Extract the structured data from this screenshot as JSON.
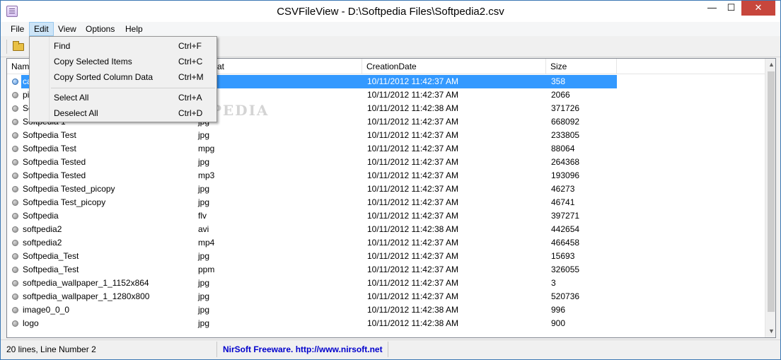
{
  "window": {
    "title": "CSVFileView  -  D:\\Softpedia Files\\Softpedia2.csv",
    "controls": {
      "minimize": "—",
      "maximize": "☐",
      "close": "✕"
    }
  },
  "menubar": {
    "items": [
      {
        "label": "File"
      },
      {
        "label": "Edit"
      },
      {
        "label": "View"
      },
      {
        "label": "Options"
      },
      {
        "label": "Help"
      }
    ],
    "active": "Edit"
  },
  "edit_menu": {
    "items": [
      {
        "label": "Find",
        "shortcut": "Ctrl+F"
      },
      {
        "label": "Copy Selected Items",
        "shortcut": "Ctrl+C"
      },
      {
        "label": "Copy Sorted Column Data",
        "shortcut": "Ctrl+M"
      },
      {
        "label": "Select All",
        "shortcut": "Ctrl+A"
      },
      {
        "label": "Deselect All",
        "shortcut": "Ctrl+D"
      }
    ]
  },
  "list": {
    "columns": [
      "Name",
      "Format",
      "CreationDate",
      "Size"
    ],
    "rows": [
      {
        "name": "ca",
        "format": "",
        "date": "10/11/2012 11:42:37 AM",
        "size": "358",
        "selected": true
      },
      {
        "name": "pi",
        "format": "",
        "date": "10/11/2012 11:42:37 AM",
        "size": "2066"
      },
      {
        "name": "So",
        "format": "",
        "date": "10/11/2012 11:42:38 AM",
        "size": "371726"
      },
      {
        "name": "Softpedia 1",
        "format": "jpg",
        "date": "10/11/2012 11:42:37 AM",
        "size": "668092"
      },
      {
        "name": "Softpedia Test",
        "format": "jpg",
        "date": "10/11/2012 11:42:37 AM",
        "size": "233805"
      },
      {
        "name": "Softpedia Test",
        "format": "mpg",
        "date": "10/11/2012 11:42:37 AM",
        "size": "88064"
      },
      {
        "name": "Softpedia Tested",
        "format": "jpg",
        "date": "10/11/2012 11:42:37 AM",
        "size": "264368"
      },
      {
        "name": "Softpedia Tested",
        "format": "mp3",
        "date": "10/11/2012 11:42:37 AM",
        "size": "193096"
      },
      {
        "name": "Softpedia Tested_picopy",
        "format": "jpg",
        "date": "10/11/2012 11:42:37 AM",
        "size": "46273"
      },
      {
        "name": "Softpedia Test_picopy",
        "format": "jpg",
        "date": "10/11/2012 11:42:37 AM",
        "size": "46741"
      },
      {
        "name": "Softpedia",
        "format": "flv",
        "date": "10/11/2012 11:42:37 AM",
        "size": "397271"
      },
      {
        "name": "softpedia2",
        "format": "avi",
        "date": "10/11/2012 11:42:38 AM",
        "size": "442654"
      },
      {
        "name": "softpedia2",
        "format": "mp4",
        "date": "10/11/2012 11:42:37 AM",
        "size": "466458"
      },
      {
        "name": "Softpedia_Test",
        "format": "jpg",
        "date": "10/11/2012 11:42:37 AM",
        "size": "15693"
      },
      {
        "name": "Softpedia_Test",
        "format": "ppm",
        "date": "10/11/2012 11:42:37 AM",
        "size": "326055"
      },
      {
        "name": "softpedia_wallpaper_1_1152x864",
        "format": "jpg",
        "date": "10/11/2012 11:42:37 AM",
        "size": "3"
      },
      {
        "name": "softpedia_wallpaper_1_1280x800",
        "format": "jpg",
        "date": "10/11/2012 11:42:37 AM",
        "size": "520736"
      },
      {
        "name": "image0_0_0",
        "format": "jpg",
        "date": "10/11/2012 11:42:38 AM",
        "size": "996"
      },
      {
        "name": "logo",
        "format": "jpg",
        "date": "10/11/2012 11:42:38 AM",
        "size": "900"
      }
    ]
  },
  "status": {
    "lines": "20 lines, Line Number 2",
    "link": "NirSoft Freeware.  http://www.nirsoft.net"
  },
  "watermark": "SOFTPEDIA",
  "colors": {
    "selection": "#3399ff",
    "close_button": "#c7463c",
    "link": "#0000cc"
  }
}
